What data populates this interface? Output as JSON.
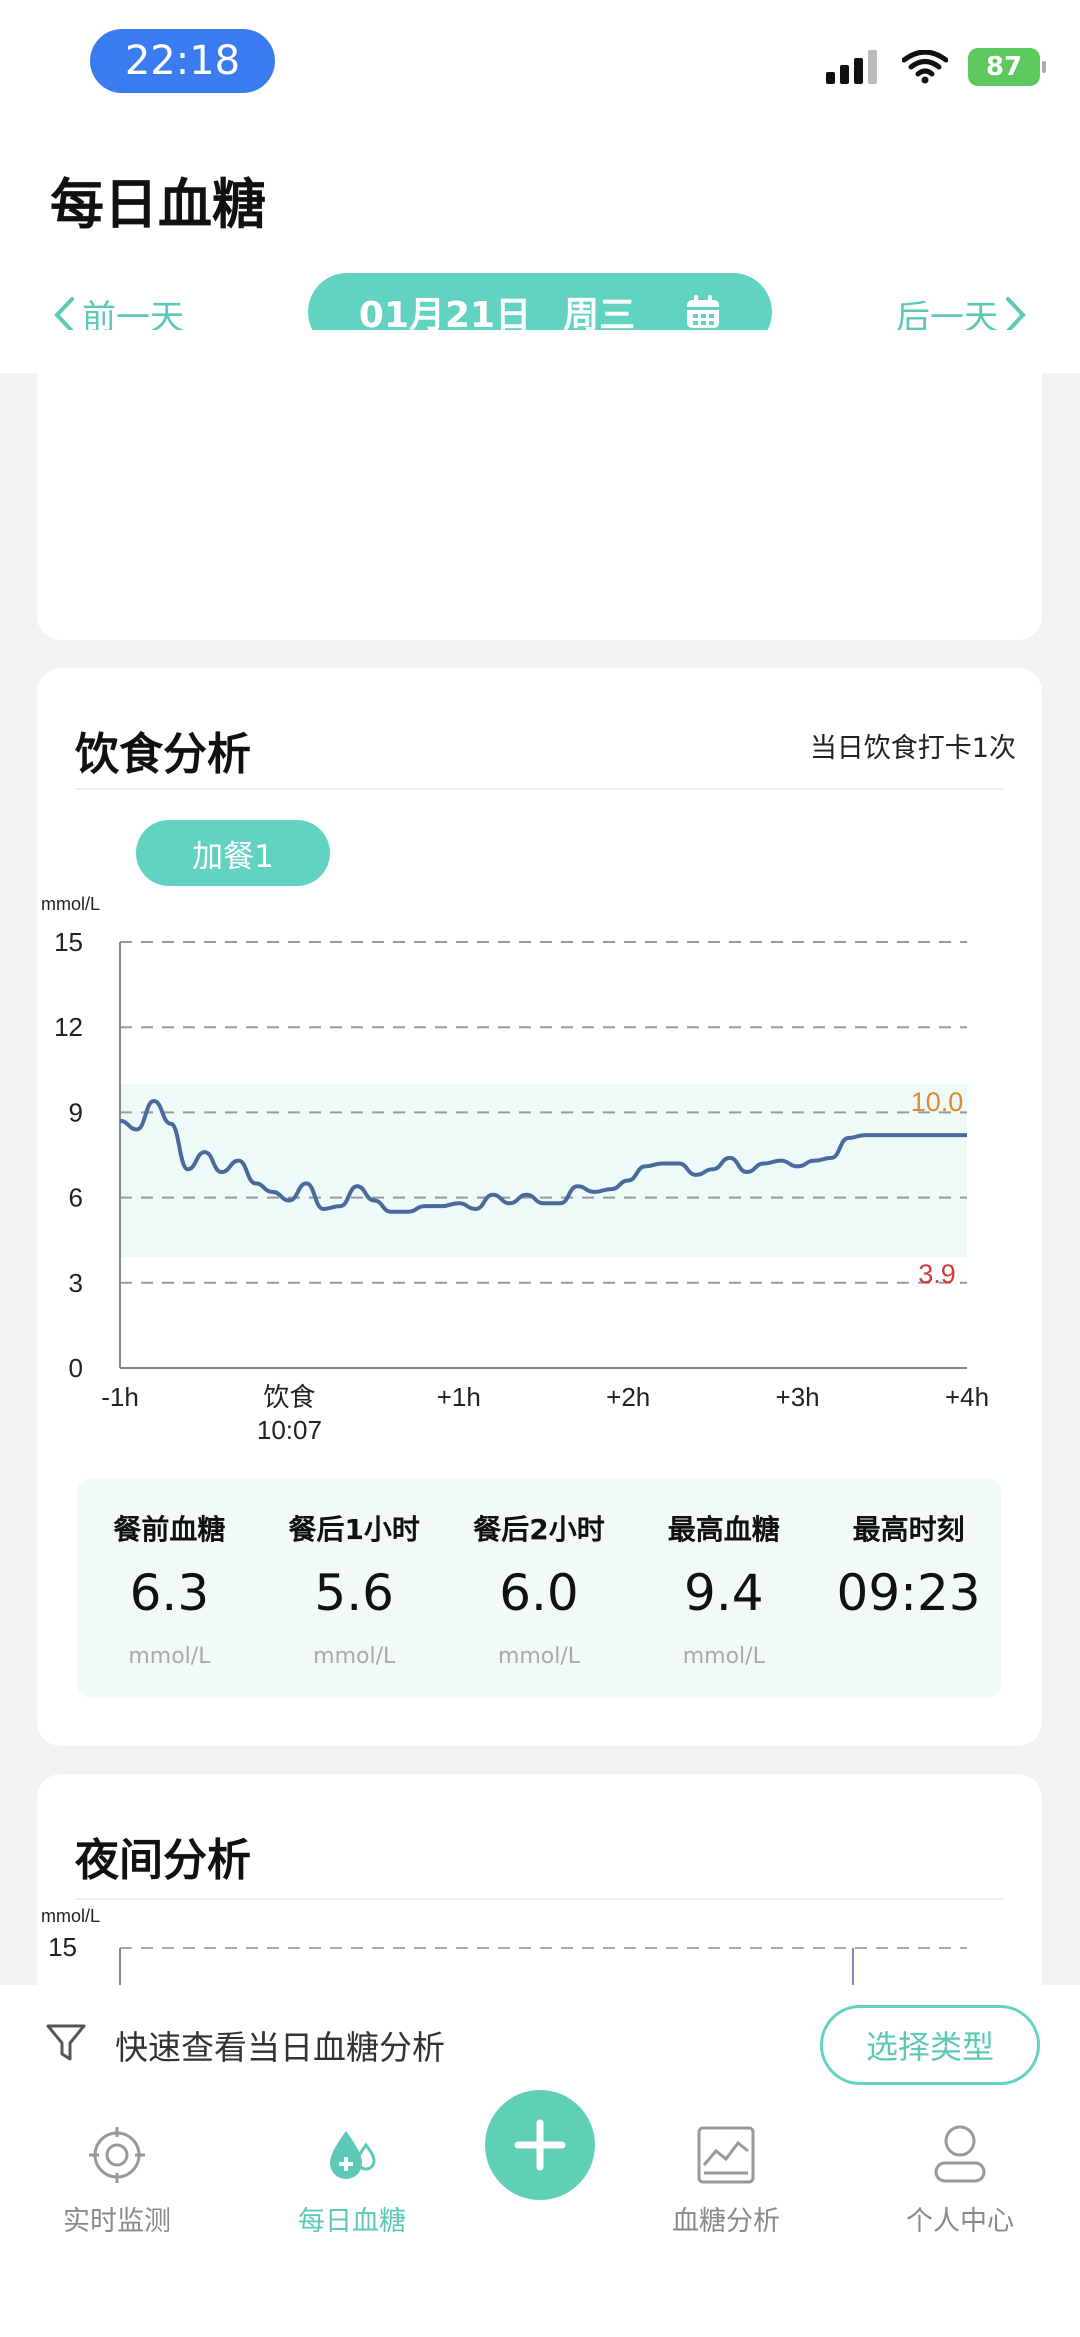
{
  "status": {
    "time": "22:18",
    "battery": "87"
  },
  "header": {
    "title": "每日血糖",
    "prev_label": "前一天",
    "next_label": "后一天",
    "date_label": "01月21日",
    "weekday_label": "周三"
  },
  "diet": {
    "title": "饮食分析",
    "subtitle": "当日饮食打卡1次",
    "meal_chip": "加餐1",
    "stats": [
      {
        "label": "餐前血糖",
        "value": "6.3",
        "unit": "mmol/L"
      },
      {
        "label": "餐后1小时",
        "value": "5.6",
        "unit": "mmol/L"
      },
      {
        "label": "餐后2小时",
        "value": "6.0",
        "unit": "mmol/L"
      },
      {
        "label": "最高血糖",
        "value": "9.4",
        "unit": "mmol/L"
      },
      {
        "label": "最高时刻",
        "value": "09:23",
        "unit": ""
      }
    ]
  },
  "chart_data": {
    "type": "line",
    "ylabel": "mmol/L",
    "ylim": [
      0,
      15
    ],
    "yticks": [
      "0",
      "3",
      "6",
      "9",
      "12",
      "15"
    ],
    "xticks": [
      "-1h",
      "饮食\n10:07",
      "+1h",
      "+2h",
      "+3h",
      "+4h"
    ],
    "target_range": {
      "low": 3.9,
      "high": 10.0,
      "low_label": "3.9",
      "high_label": "10.0"
    },
    "colors": {
      "line": "#4a6a9e",
      "band": "#eefaf7",
      "high": "#e08a2a",
      "low": "#d33a3a"
    },
    "series": [
      {
        "x": [
          -1.0,
          -0.9,
          -0.8,
          -0.7,
          -0.6,
          -0.5,
          -0.4,
          -0.3,
          -0.2,
          -0.1,
          0.0,
          0.1,
          0.2,
          0.3,
          0.4,
          0.5,
          0.6,
          0.7,
          0.8,
          0.9,
          1.0,
          1.1,
          1.2,
          1.3,
          1.4,
          1.5,
          1.6,
          1.7,
          1.8,
          1.9,
          2.0,
          2.1,
          2.2,
          2.3,
          2.4,
          2.5,
          2.6,
          2.7,
          2.8,
          2.9,
          3.0,
          3.1,
          3.2,
          3.3,
          3.4,
          3.5,
          3.6,
          3.7,
          3.8,
          3.9,
          4.0
        ],
        "y": [
          8.7,
          8.4,
          9.4,
          8.6,
          7.0,
          7.6,
          6.9,
          7.3,
          6.5,
          6.2,
          5.9,
          6.5,
          5.6,
          5.7,
          6.4,
          5.9,
          5.5,
          5.5,
          5.7,
          5.7,
          5.8,
          5.6,
          6.1,
          5.8,
          6.1,
          5.8,
          5.8,
          6.4,
          6.2,
          6.3,
          6.6,
          7.1,
          7.2,
          7.2,
          6.8,
          7.0,
          7.4,
          6.9,
          7.2,
          7.3,
          7.1,
          7.3,
          7.4,
          8.1,
          8.2,
          8.2,
          8.2,
          8.2,
          8.2,
          8.2,
          8.2
        ]
      }
    ]
  },
  "night": {
    "title": "夜间分析",
    "ylabel": "mmol/L",
    "ytop": "15"
  },
  "filter": {
    "text": "快速查看当日血糖分析",
    "button": "选择类型"
  },
  "tabs": {
    "realtime": "实时监测",
    "daily": "每日血糖",
    "analysis": "血糖分析",
    "profile": "个人中心"
  }
}
